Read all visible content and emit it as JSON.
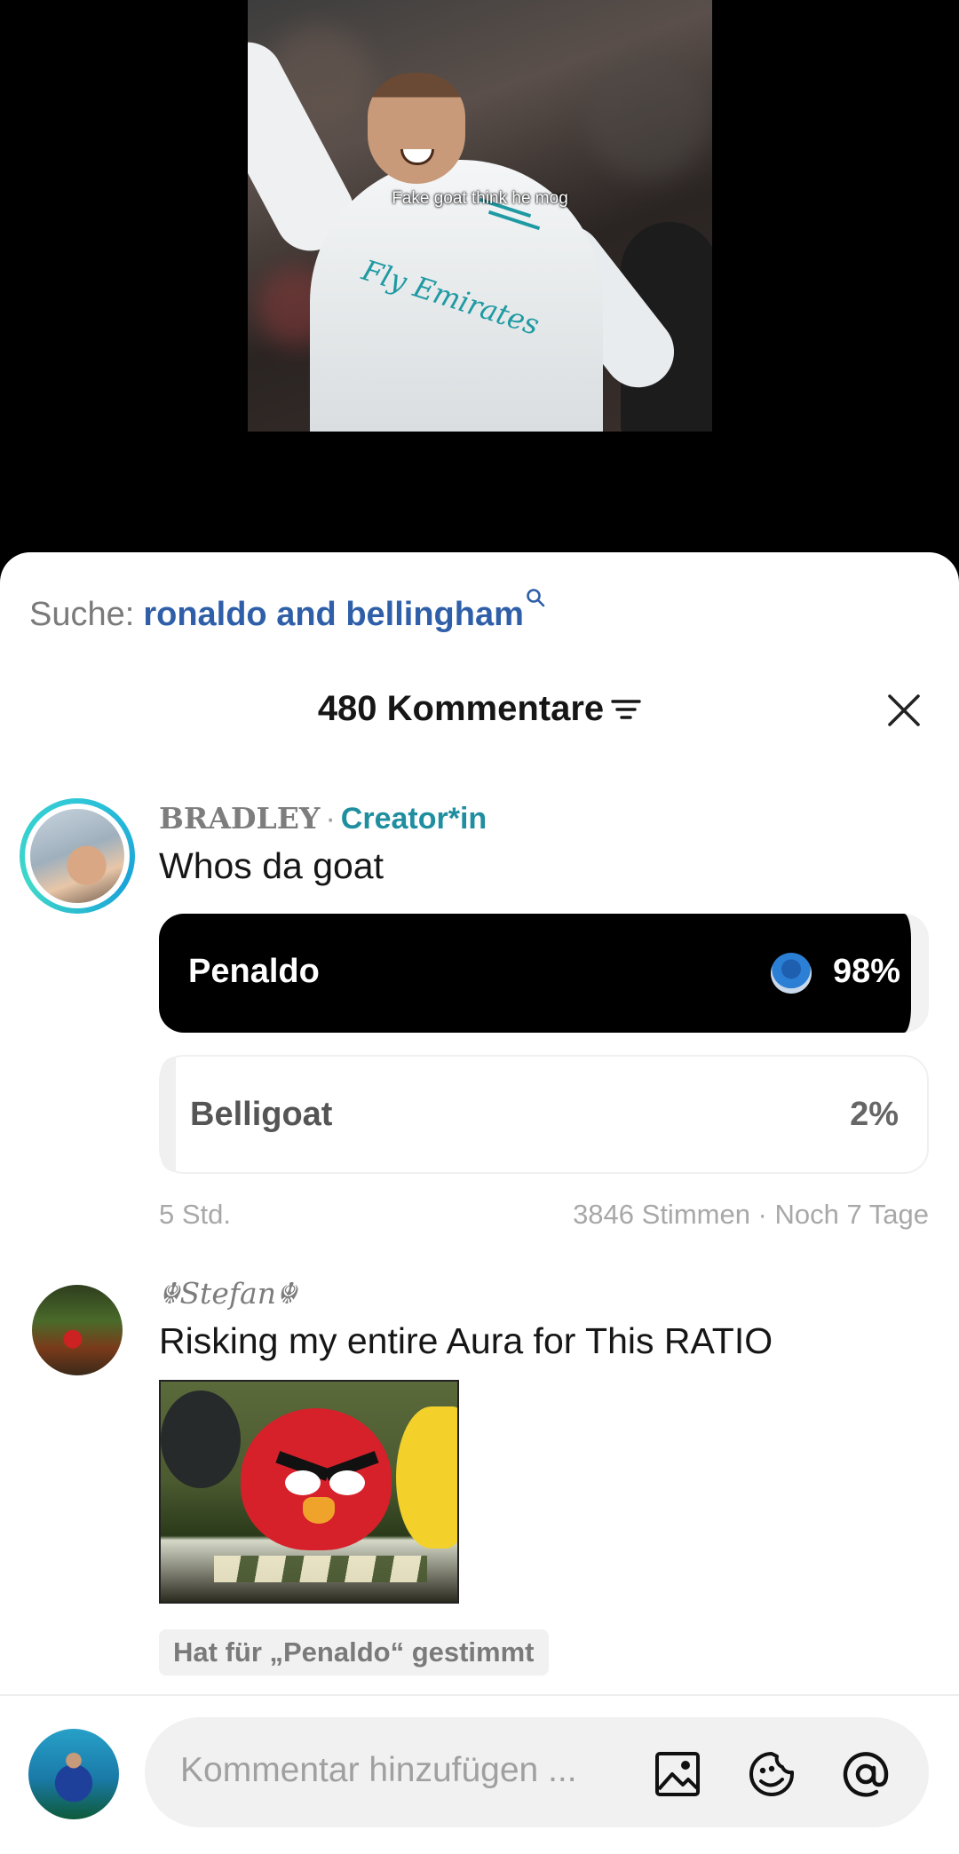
{
  "video": {
    "caption": "Fake goat think he mog",
    "shirt_text": "Fly Emirates"
  },
  "search": {
    "prefix": "Suche:",
    "term": "ronaldo and bellingham"
  },
  "comments_header": {
    "title": "480 Kommentare"
  },
  "comment1": {
    "username": "BRADLEY",
    "separator": "·",
    "badge": "Creator*in",
    "text": "Whos da goat",
    "poll": {
      "options": [
        {
          "label": "Penaldo",
          "percent_text": "98%",
          "percent": 98
        },
        {
          "label": "Belligoat",
          "percent_text": "2%",
          "percent": 2
        }
      ],
      "age": "5 Std.",
      "votes_info": "3846 Stimmen · Noch 7 Tage"
    }
  },
  "comment2": {
    "username": "☬Stefan☬",
    "text": "Risking my entire Aura for This RATIO",
    "vote_badge": "Hat für „Penaldo“ gestimmt"
  },
  "composer": {
    "placeholder": "Kommentar hinzufügen ..."
  },
  "icons": {
    "search": "search-icon",
    "filter": "filter-icon",
    "close": "close-icon",
    "image": "image-icon",
    "sticker": "sticker-icon",
    "mention": "at-icon"
  },
  "colors": {
    "search_term": "#2f5fa8",
    "creator_badge": "#1f8fa0",
    "avatar_ring": "#2ec7d8"
  }
}
